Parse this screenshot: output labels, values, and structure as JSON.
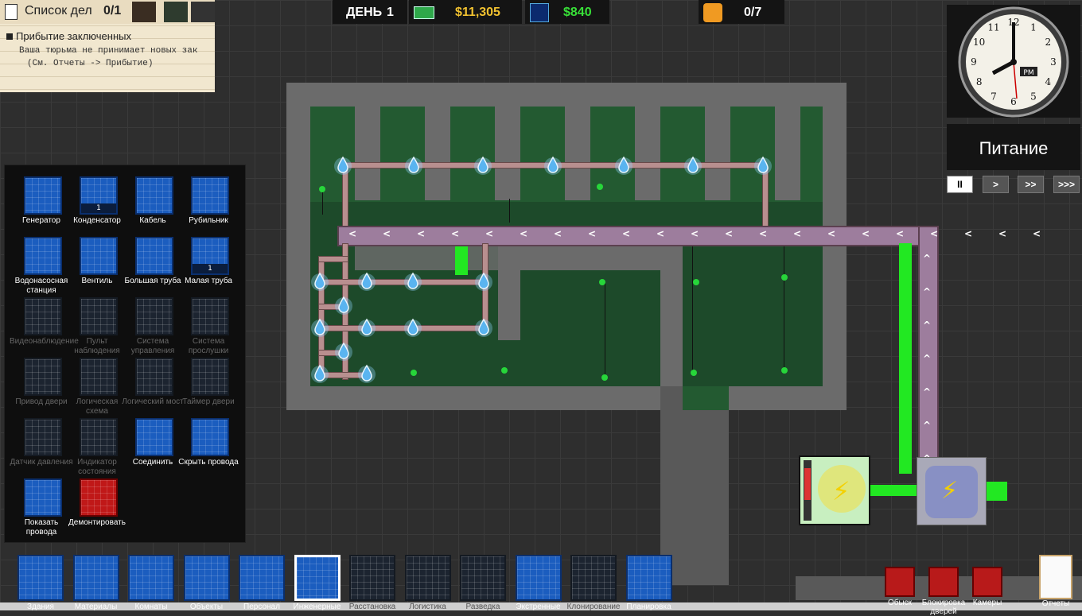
{
  "todo": {
    "title": "Список дел",
    "count": "0/1",
    "item_title": "Прибытие заключенных",
    "item_line1": "Ваша тюрьма не принимает новых зак",
    "item_line2": "(См. Отчеты -> Прибытие)"
  },
  "hud": {
    "day_label": "ДЕНЬ",
    "day_value": "1",
    "money": "$11,305",
    "balance": "$840",
    "prisoners": "0/7"
  },
  "clock": {
    "pm": "PM",
    "numbers": [
      "12",
      "1",
      "2",
      "3",
      "4",
      "5",
      "6",
      "7",
      "8",
      "9",
      "10",
      "11"
    ]
  },
  "regime": "Питание",
  "speed": [
    "II",
    ">",
    ">>",
    ">>>"
  ],
  "tools": [
    {
      "label": "Генератор",
      "dim": false
    },
    {
      "label": "Конденсатор",
      "dim": false,
      "badge": "1"
    },
    {
      "label": "Кабель",
      "dim": false
    },
    {
      "label": "Рубильник",
      "dim": false
    },
    {
      "label": "Водонасосная станция",
      "dim": false
    },
    {
      "label": "Вентиль",
      "dim": false
    },
    {
      "label": "Большая труба",
      "dim": false
    },
    {
      "label": "Малая труба",
      "dim": false,
      "badge": "1"
    },
    {
      "label": "Видеонаблюдение",
      "dim": true
    },
    {
      "label": "Пульт наблюдения",
      "dim": true
    },
    {
      "label": "Система управления",
      "dim": true
    },
    {
      "label": "Система прослушки",
      "dim": true
    },
    {
      "label": "Привод двери",
      "dim": true
    },
    {
      "label": "Логическая схема",
      "dim": true
    },
    {
      "label": "Логический мост",
      "dim": true
    },
    {
      "label": "Таймер двери",
      "dim": true
    },
    {
      "label": "Датчик давления",
      "dim": true
    },
    {
      "label": "Индикатор состояния",
      "dim": true
    },
    {
      "label": "Соединить",
      "dim": false
    },
    {
      "label": "Скрыть провода",
      "dim": false
    },
    {
      "label": "Показать провода",
      "dim": false
    },
    {
      "label": "Демонтировать",
      "dim": false,
      "red": true
    }
  ],
  "bottom_tools": [
    {
      "label": "Здания",
      "dim": false
    },
    {
      "label": "Материалы",
      "dim": false
    },
    {
      "label": "Комнаты",
      "dim": false
    },
    {
      "label": "Объекты",
      "dim": false
    },
    {
      "label": "Персонал",
      "dim": false
    },
    {
      "label": "Инженерные",
      "dim": false,
      "selected": true
    },
    {
      "label": "Расстановка",
      "dim": true
    },
    {
      "label": "Логистика",
      "dim": true
    },
    {
      "label": "Разведка",
      "dim": true
    },
    {
      "label": "Экстренные",
      "dim": false
    },
    {
      "label": "Клонирование",
      "dim": true
    },
    {
      "label": "Планировка",
      "dim": false
    }
  ],
  "right_tools": [
    {
      "label": "Обыск"
    },
    {
      "label": "Блокировка дверей"
    },
    {
      "label": "Камеры"
    }
  ],
  "reports": "Отчеты",
  "colors": {
    "accent": "#1b5dbf",
    "money": "#f2c230",
    "balance": "#38e038",
    "floor": "#1d4a2a"
  }
}
